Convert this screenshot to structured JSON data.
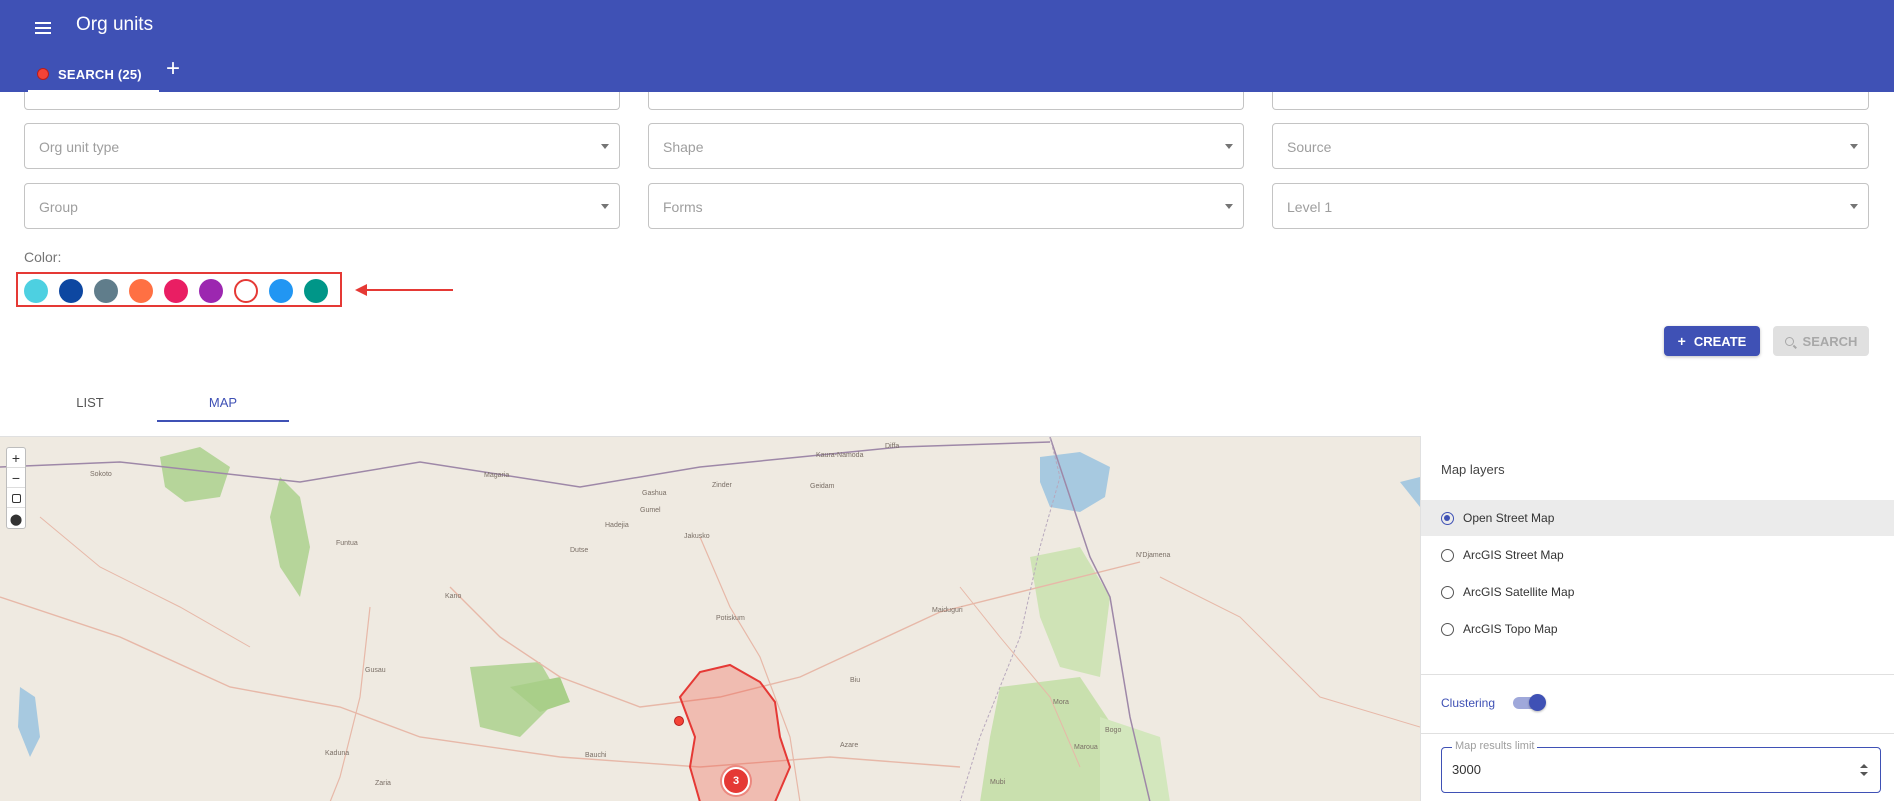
{
  "appbar": {
    "title": "Org units",
    "search_tab": "SEARCH (25)",
    "add_tab": "+"
  },
  "filters": {
    "org_unit_type": "Org unit type",
    "shape": "Shape",
    "source": "Source",
    "group": "Group",
    "forms": "Forms",
    "level": "Level 1"
  },
  "color": {
    "label": "Color:",
    "swatches": [
      "#4dd0e1",
      "#0d47a1",
      "#607d8b",
      "#ff7043",
      "#e91e63",
      "#9c27b0",
      "#ffffff",
      "#2196f3",
      "#009688"
    ],
    "selected_index": 6
  },
  "actions": {
    "create": "CREATE",
    "search": "SEARCH"
  },
  "view_tabs": {
    "list": "LIST",
    "map": "MAP"
  },
  "map": {
    "zoom_in": "+",
    "zoom_out": "−",
    "cluster_count": "3",
    "labels": [
      "Sokoto",
      "Kano",
      "Kaduna",
      "Maiduguri",
      "N'Djamena",
      "Gashua",
      "Potiskum",
      "Bauchi",
      "Dutse",
      "Jakusko",
      "Kaura-Namoda",
      "Gusau",
      "Azare",
      "Mora",
      "Maroua",
      "Bogo",
      "Magaria",
      "Diffa",
      "Geidam",
      "Hadejia",
      "Funtua",
      "Zaria",
      "Zinder",
      "Gumel",
      "Biu",
      "Mubi"
    ]
  },
  "panel": {
    "title": "Map layers",
    "layers": [
      "Open Street Map",
      "ArcGIS Street Map",
      "ArcGIS Satellite Map",
      "ArcGIS Topo Map"
    ],
    "selected_layer": "Open Street Map",
    "clustering_label": "Clustering",
    "clustering_on": true,
    "limit_label": "Map results limit",
    "limit_value": "3000"
  },
  "colors": {
    "primary": "#3f51b5",
    "highlight": "#e53935"
  }
}
